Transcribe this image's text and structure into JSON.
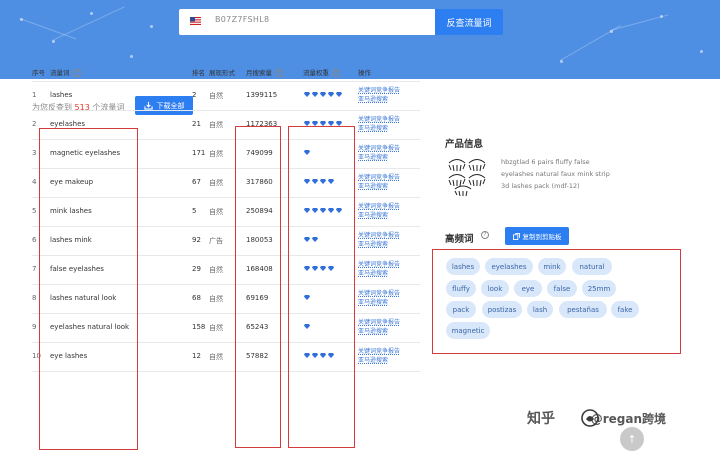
{
  "header": {
    "search_value": "B07Z7FSHL8",
    "search_button": "反查流量词",
    "country": "US"
  },
  "summary": {
    "prefix": "为您反查到",
    "count": "513",
    "suffix": "个流量词",
    "download_label": "下载全部"
  },
  "table": {
    "headers": {
      "index": "序号",
      "keyword": "流量词",
      "rank": "排名",
      "display": "展现形式",
      "volume": "月搜索量",
      "weight": "流量权重",
      "action": "操作"
    },
    "rows": [
      {
        "index": "1",
        "keyword": "lashes",
        "rank": "2",
        "display": "自然",
        "volume": "1399115",
        "weight": 5
      },
      {
        "index": "2",
        "keyword": "eyelashes",
        "rank": "21",
        "display": "自然",
        "volume": "1172363",
        "weight": 5
      },
      {
        "index": "3",
        "keyword": "magnetic eyelashes",
        "rank": "171",
        "display": "自然",
        "volume": "749099",
        "weight": 1
      },
      {
        "index": "4",
        "keyword": "eye makeup",
        "rank": "67",
        "display": "自然",
        "volume": "317860",
        "weight": 4
      },
      {
        "index": "5",
        "keyword": "mink lashes",
        "rank": "5",
        "display": "自然",
        "volume": "250894",
        "weight": 5
      },
      {
        "index": "6",
        "keyword": "lashes mink",
        "rank": "92",
        "display": "广告",
        "volume": "180053",
        "weight": 2
      },
      {
        "index": "7",
        "keyword": "false eyelashes",
        "rank": "29",
        "display": "自然",
        "volume": "168408",
        "weight": 4
      },
      {
        "index": "8",
        "keyword": "lashes natural look",
        "rank": "68",
        "display": "自然",
        "volume": "69169",
        "weight": 1
      },
      {
        "index": "9",
        "keyword": "eyelashes natural look",
        "rank": "158",
        "display": "自然",
        "volume": "65243",
        "weight": 1
      },
      {
        "index": "10",
        "keyword": "eye lashes",
        "rank": "12",
        "display": "自然",
        "volume": "57882",
        "weight": 4
      }
    ],
    "action_line1": "关键词竞争报告",
    "action_line2": "亚马逊搜索"
  },
  "product": {
    "section_title": "产品信息",
    "line1": "hbzgtlad 6 pairs fluffy false",
    "line2": "eyelashes natural faux mink strip",
    "line3": "3d lashes pack (mdf-12)"
  },
  "frequent": {
    "section_title": "高频词",
    "copy_button": "复制到剪贴板",
    "tags": [
      "lashes",
      "eyelashes",
      "mink",
      "natural",
      "fluffy",
      "look",
      "eye",
      "false",
      "25mm",
      "pack",
      "postizas",
      "lash",
      "pestañas",
      "fake",
      "magnetic"
    ]
  },
  "watermark": {
    "site": "知乎",
    "author": "@regan跨境"
  },
  "colors": {
    "banner": "#4f8fe3",
    "primary": "#2d7ef0",
    "highlight": "#d63b3b",
    "tag_bg": "#d8e7f9"
  }
}
